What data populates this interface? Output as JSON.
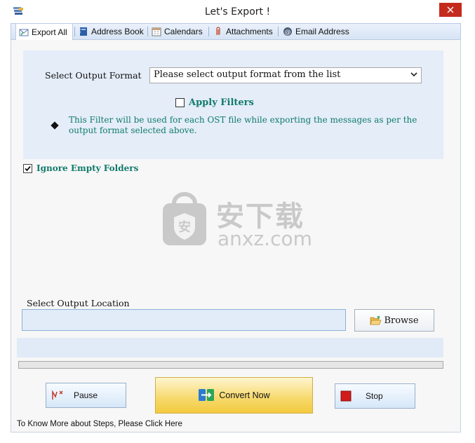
{
  "window": {
    "title": "Let's Export !",
    "icon": "app-icon",
    "close_icon": "close-icon"
  },
  "tabs": [
    {
      "label": "Export All",
      "icon": "envelope-icon",
      "active": true
    },
    {
      "label": "Address Book",
      "icon": "address-book-icon",
      "active": false
    },
    {
      "label": "Calendars",
      "icon": "calendar-icon",
      "active": false
    },
    {
      "label": "Attachments",
      "icon": "paperclip-icon",
      "active": false
    },
    {
      "label": "Email Address",
      "icon": "at-sign-icon",
      "active": false
    }
  ],
  "format": {
    "label": "Select Output Format",
    "selected": "Please select output format from the list"
  },
  "filters": {
    "apply_label": "Apply Filters",
    "apply_checked": false,
    "note": "This Filter will be used for each OST file while exporting the messages as per the output format selected above."
  },
  "ignore_empty": {
    "label": "Ignore Empty Folders",
    "checked": true
  },
  "watermark": {
    "text": "安下载",
    "sub": "anxz.com"
  },
  "output": {
    "label": "Select Output Location",
    "value": "",
    "browse_label": "Browse"
  },
  "progress": {
    "fraction": 0
  },
  "actions": {
    "pause_label": "Pause",
    "convert_label": "Convert Now",
    "stop_label": "Stop"
  },
  "help": {
    "text": "To Know More about Steps, Please Click Here"
  },
  "colors": {
    "accent_teal": "#127a6c",
    "close_red": "#c42b1c",
    "panel_blue": "#e4edf8",
    "convert_yellow": "#f6d86a"
  }
}
